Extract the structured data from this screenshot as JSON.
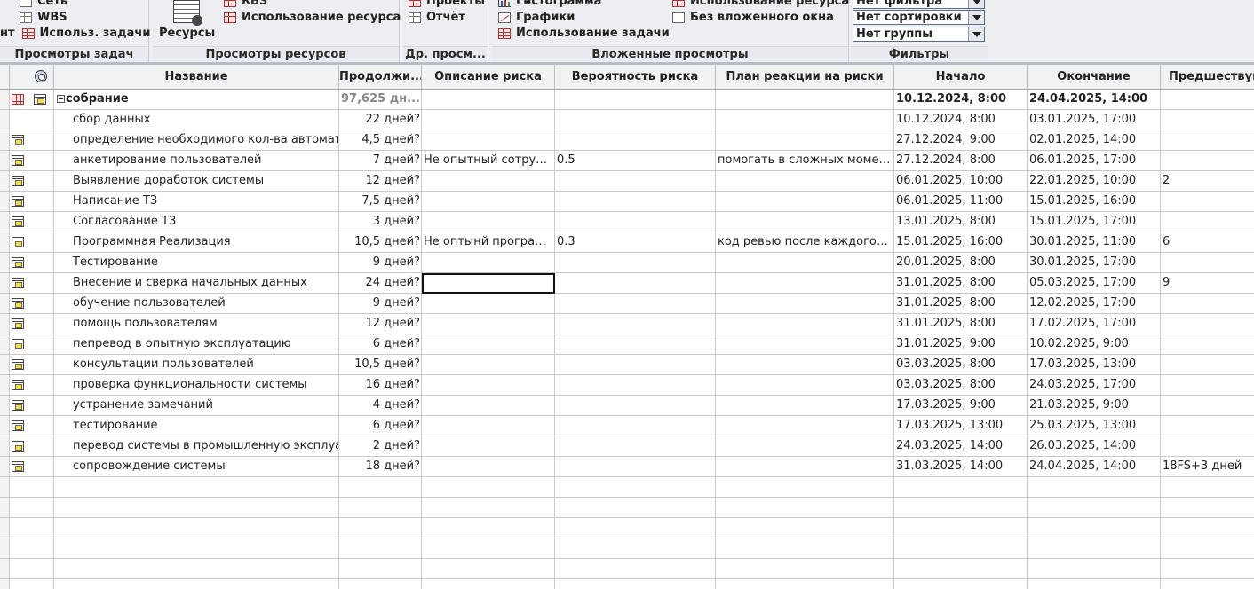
{
  "ribbon": {
    "task_views": {
      "title": "Просмотры задач",
      "items": [
        "Сеть",
        "WBS",
        "Использ. задачи"
      ],
      "cut_label": "нт"
    },
    "resource_views": {
      "title": "Просмотры ресурсов",
      "big_label": "Ресурсы",
      "items": [
        "RBS",
        "Использование ресурса"
      ]
    },
    "other_views": {
      "title": "Др. просм...",
      "items": [
        "Проекты",
        "Отчёт"
      ]
    },
    "nested_views": {
      "title": "Вложенные просмотры",
      "items": [
        "Гистограмма",
        "Графики",
        "Использование задачи",
        "Использование ресурса",
        "Без вложенного окна"
      ]
    },
    "filters": {
      "title": "Фильтры",
      "filter_value": "Нет фильтра",
      "sort_value": "Нет сортировки",
      "group_value": "Нет группы"
    }
  },
  "table": {
    "columns": {
      "name": "Название",
      "duration": "Продолжи...",
      "risk_description": "Описание риска",
      "risk_probability": "Вероятность риска",
      "risk_response": "План реакции на риски",
      "start": "Начало",
      "finish": "Окончание",
      "predecessors": "Предшествую"
    },
    "summary": {
      "name": "собрание",
      "duration": "97,625 дн...",
      "start": "10.12.2024, 8:00",
      "finish": "24.04.2025, 14:00"
    },
    "rows": [
      {
        "name": "сбор данных",
        "duration": "22 дней?",
        "risk": "",
        "prob": "",
        "plan": "",
        "start": "10.12.2024, 8:00",
        "finish": "03.01.2025, 17:00",
        "pred": ""
      },
      {
        "name": "определение необходимого кол-ва автомат",
        "duration": "4,5 дней?",
        "risk": "",
        "prob": "",
        "plan": "",
        "start": "27.12.2024, 9:00",
        "finish": "02.01.2025, 14:00",
        "pred": ""
      },
      {
        "name": "анкетирование пользователей",
        "duration": "7 дней?",
        "risk": "Не опытный сотруд...",
        "prob": "0.5",
        "plan": "помогать в сложных момен...",
        "start": "27.12.2024, 8:00",
        "finish": "06.01.2025, 17:00",
        "pred": ""
      },
      {
        "name": "Выявление доработок системы",
        "duration": "12 дней?",
        "risk": "",
        "prob": "",
        "plan": "",
        "start": "06.01.2025, 10:00",
        "finish": "22.01.2025, 10:00",
        "pred": "2"
      },
      {
        "name": "Написание ТЗ",
        "duration": "7,5 дней?",
        "risk": "",
        "prob": "",
        "plan": "",
        "start": "06.01.2025, 11:00",
        "finish": "15.01.2025, 16:00",
        "pred": ""
      },
      {
        "name": "Согласование ТЗ",
        "duration": "3 дней?",
        "risk": "",
        "prob": "",
        "plan": "",
        "start": "13.01.2025, 8:00",
        "finish": "15.01.2025, 17:00",
        "pred": ""
      },
      {
        "name": "Программная Реализация",
        "duration": "10,5 дней?",
        "risk": "Не оптынй програм...",
        "prob": "0.3",
        "plan": "код ревью после каждого к...",
        "start": "15.01.2025, 16:00",
        "finish": "30.01.2025, 11:00",
        "pred": "6"
      },
      {
        "name": "Тестирование",
        "duration": "9 дней?",
        "risk": "",
        "prob": "",
        "plan": "",
        "start": "20.01.2025, 8:00",
        "finish": "30.01.2025, 17:00",
        "pred": ""
      },
      {
        "name": "Внесение и сверка начальных данных",
        "duration": "24 дней?",
        "risk": "",
        "prob": "",
        "plan": "",
        "start": "31.01.2025, 8:00",
        "finish": "05.03.2025, 17:00",
        "pred": "9"
      },
      {
        "name": "обучение пользователей",
        "duration": "9 дней?",
        "risk": "",
        "prob": "",
        "plan": "",
        "start": "31.01.2025, 8:00",
        "finish": "12.02.2025, 17:00",
        "pred": ""
      },
      {
        "name": "помощь пользователям",
        "duration": "12 дней?",
        "risk": "",
        "prob": "",
        "plan": "",
        "start": "31.01.2025, 8:00",
        "finish": "17.02.2025, 17:00",
        "pred": ""
      },
      {
        "name": "пепревод в опытную эксплуатацию",
        "duration": "6 дней?",
        "risk": "",
        "prob": "",
        "plan": "",
        "start": "31.01.2025, 9:00",
        "finish": "10.02.2025, 9:00",
        "pred": ""
      },
      {
        "name": "консультации пользователей",
        "duration": "10,5 дней?",
        "risk": "",
        "prob": "",
        "plan": "",
        "start": "03.03.2025, 8:00",
        "finish": "17.03.2025, 13:00",
        "pred": ""
      },
      {
        "name": "проверка функциональности системы",
        "duration": "16 дней?",
        "risk": "",
        "prob": "",
        "plan": "",
        "start": "03.03.2025, 8:00",
        "finish": "24.03.2025, 17:00",
        "pred": ""
      },
      {
        "name": "устранение замечаний",
        "duration": "4 дней?",
        "risk": "",
        "prob": "",
        "plan": "",
        "start": "17.03.2025, 9:00",
        "finish": "21.03.2025, 9:00",
        "pred": ""
      },
      {
        "name": "тестирование",
        "duration": "6 дней?",
        "risk": "",
        "prob": "",
        "plan": "",
        "start": "17.03.2025, 13:00",
        "finish": "25.03.2025, 13:00",
        "pred": ""
      },
      {
        "name": "перевод системы в промышленную эксплуата",
        "duration": "2 дней?",
        "risk": "",
        "prob": "",
        "plan": "",
        "start": "24.03.2025, 14:00",
        "finish": "26.03.2025, 14:00",
        "pred": ""
      },
      {
        "name": "сопровождение системы",
        "duration": "18 дней?",
        "risk": "",
        "prob": "",
        "plan": "",
        "start": "31.03.2025, 14:00",
        "finish": "24.04.2025, 14:00",
        "pred": "18FS+3 дней"
      }
    ],
    "selected_row_index": 8
  }
}
